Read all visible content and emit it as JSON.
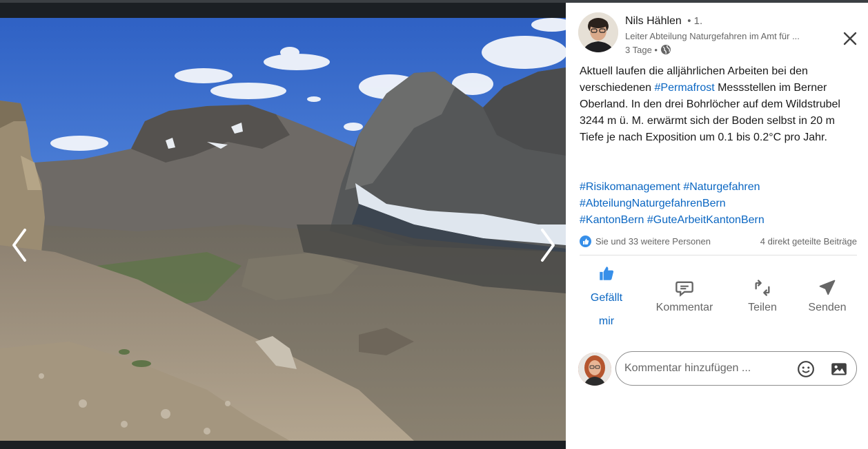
{
  "author": {
    "name": "Nils Hählen",
    "degree": "• 1.",
    "headline": "Leiter Abteilung Naturgefahren im Amt für ...",
    "time": "3 Tage •"
  },
  "post": {
    "text_1": "Aktuell laufen die alljährlichen Arbeiten bei den verschiedenen ",
    "hashtag_inline": "#Permafrost",
    "text_2": " Messstellen im Berner Oberland. In den drei Bohrlöcher auf dem Wildstrubel 3244 m ü. M. erwärmt sich der Boden selbst in 20 m Tiefe je nach Exposition um 0.1 bis 0.2°C pro Jahr.",
    "hashtags": {
      "h1": "#Risikomanagement",
      "h2": "#Naturgefahren",
      "h3": "#AbteilungNaturgefahrenBern",
      "h4": "#KantonBern",
      "h5": "#GuteArbeitKantonBern"
    }
  },
  "social": {
    "reactions": "Sie und 33 weitere Personen",
    "shares": "4 direkt geteilte Beiträge"
  },
  "actions": {
    "like_line1": "Gefällt",
    "like_line2": "mir",
    "comment": "Kommentar",
    "share": "Teilen",
    "send": "Senden"
  },
  "comment_input": {
    "placeholder": "Kommentar hinzufügen ..."
  },
  "icons": {
    "prev": "chevron-left-icon",
    "next": "chevron-right-icon",
    "close": "close-icon",
    "globe": "globe-icon",
    "like": "thumbs-up-icon",
    "comment": "comment-icon",
    "share": "repost-icon",
    "send": "send-icon",
    "emoji": "emoji-icon",
    "image": "image-icon"
  },
  "colors": {
    "accent": "#0a66c2",
    "text": "#191919",
    "muted": "#666666"
  }
}
